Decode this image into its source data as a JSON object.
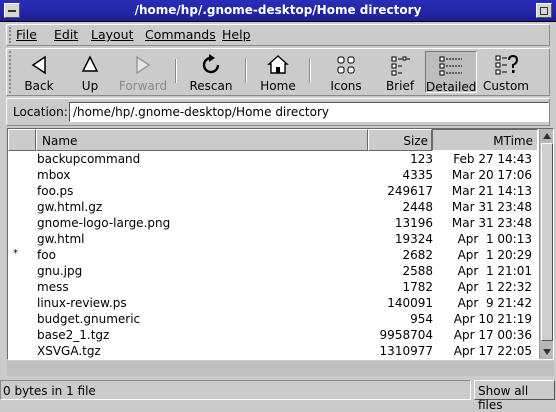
{
  "window": {
    "title": "/home/hp/.gnome-desktop/Home directory"
  },
  "menubar": {
    "items": [
      {
        "label": "File"
      },
      {
        "label": "Edit"
      },
      {
        "label": "Layout"
      },
      {
        "label": "Commands"
      },
      {
        "label": "Help"
      }
    ]
  },
  "toolbar": {
    "back": {
      "label": "Back",
      "icon": "left-arrow-icon"
    },
    "up": {
      "label": "Up",
      "icon": "up-arrow-icon"
    },
    "forward": {
      "label": "Forward",
      "icon": "right-arrow-icon",
      "disabled": true
    },
    "rescan": {
      "label": "Rescan",
      "icon": "refresh-icon"
    },
    "home": {
      "label": "Home",
      "icon": "home-icon"
    },
    "icons": {
      "label": "Icons",
      "icon": "icons-view-icon"
    },
    "brief": {
      "label": "Brief",
      "icon": "brief-view-icon"
    },
    "detailed": {
      "label": "Detailed",
      "icon": "detailed-view-icon",
      "active": true
    },
    "custom": {
      "label": "Custom",
      "icon": "custom-view-icon"
    }
  },
  "location": {
    "label": "Location:",
    "value": "/home/hp/.gnome-desktop/Home directory"
  },
  "list": {
    "columns": {
      "name": "Name",
      "size": "Size",
      "mtime": "MTime"
    },
    "rows": [
      {
        "mark": "",
        "name": "backupcommand",
        "size": "123",
        "mtime": "Feb 27 14:43"
      },
      {
        "mark": "",
        "name": "mbox",
        "size": "4335",
        "mtime": "Mar 20 17:06"
      },
      {
        "mark": "",
        "name": "foo.ps",
        "size": "249617",
        "mtime": "Mar 21 14:13"
      },
      {
        "mark": "",
        "name": "gw.html.gz",
        "size": "2448",
        "mtime": "Mar 31 23:48"
      },
      {
        "mark": "",
        "name": "gnome-logo-large.png",
        "size": "13196",
        "mtime": "Mar 31 23:48"
      },
      {
        "mark": "",
        "name": "gw.html",
        "size": "19324",
        "mtime": "Apr  1 00:13"
      },
      {
        "mark": "*",
        "name": "foo",
        "size": "2682",
        "mtime": "Apr  1 20:29"
      },
      {
        "mark": "",
        "name": "gnu.jpg",
        "size": "2588",
        "mtime": "Apr  1 21:01"
      },
      {
        "mark": "",
        "name": "mess",
        "size": "1782",
        "mtime": "Apr  1 22:32"
      },
      {
        "mark": "",
        "name": "linux-review.ps",
        "size": "140091",
        "mtime": "Apr  9 21:42"
      },
      {
        "mark": "",
        "name": "budget.gnumeric",
        "size": "954",
        "mtime": "Apr 10 21:19"
      },
      {
        "mark": "",
        "name": "base2_1.tgz",
        "size": "9958704",
        "mtime": "Apr 17 00:36"
      },
      {
        "mark": "",
        "name": "XSVGA.tgz",
        "size": "1310977",
        "mtime": "Apr 17 22:05"
      }
    ]
  },
  "status": {
    "text": "0 bytes in 1 file",
    "show_all": "Show all files"
  }
}
